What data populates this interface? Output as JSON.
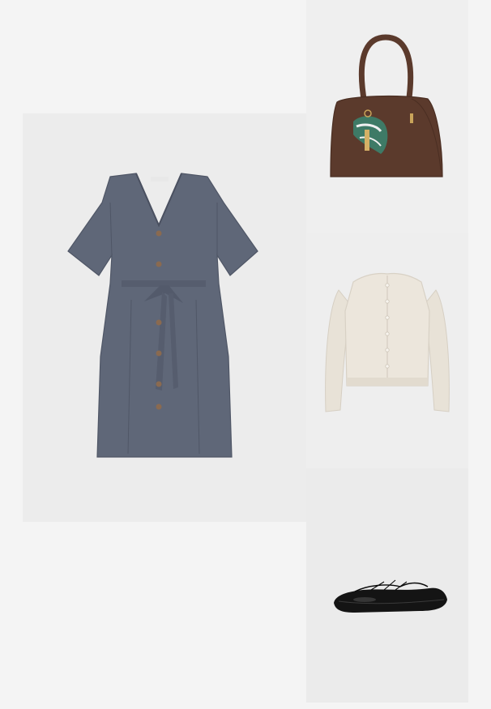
{
  "outfit": {
    "items": [
      {
        "product": "dress",
        "icon": "dress-image",
        "color": "#5f6778"
      },
      {
        "product": "handbag",
        "icon": "handbag-image",
        "color": "#5b3a2c"
      },
      {
        "product": "cardigan",
        "icon": "cardigan-image",
        "color": "#ece6dc"
      },
      {
        "product": "ballet-flats",
        "icon": "ballet-flats-image",
        "color": "#141414"
      }
    ]
  }
}
